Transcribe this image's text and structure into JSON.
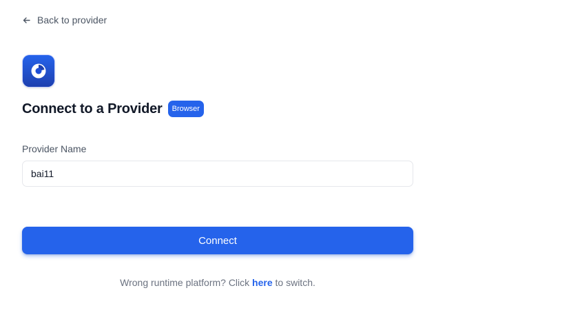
{
  "nav": {
    "back_label": "Back to provider",
    "back_icon": "arrow-left-icon"
  },
  "header": {
    "logo_icon": "provider-logo-icon",
    "title": "Connect to a Provider",
    "badge": "Browser"
  },
  "form": {
    "provider_name_label": "Provider Name",
    "provider_name_value": "bai11",
    "connect_label": "Connect"
  },
  "footer": {
    "text_before": "Wrong runtime platform? Click ",
    "link_label": "here",
    "text_after": " to switch."
  },
  "colors": {
    "accent": "#2563eb",
    "logo_background": "#1d4ed8",
    "muted_text": "#6b7280"
  }
}
